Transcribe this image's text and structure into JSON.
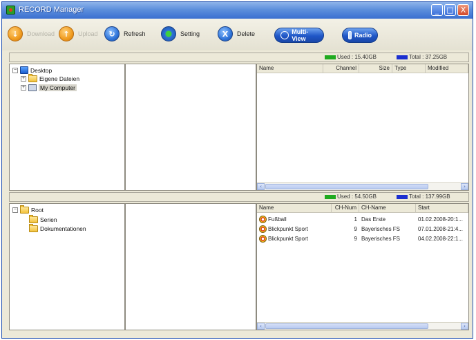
{
  "window": {
    "title": "RECORD Manager",
    "min_glyph": "_",
    "max_glyph": "□",
    "close_glyph": "X"
  },
  "toolbar": {
    "download": "Download",
    "upload": "Upload",
    "refresh": "Refresh",
    "setting": "Setting",
    "delete": "Delete",
    "multiview": "Multi-View",
    "radio": "Radio"
  },
  "top_status": {
    "used": "Used : 15.40GB",
    "total": "Total : 37.25GB"
  },
  "top_tree": {
    "desktop": "Desktop",
    "eigene_dateien": "Eigene Dateien",
    "my_computer": "My Computer"
  },
  "top_list": {
    "columns": [
      "Name",
      "Channel",
      "Size",
      "Type",
      "Modified"
    ]
  },
  "bottom_status": {
    "used": "Used : 54.50GB",
    "total": "Total : 137.99GB"
  },
  "bottom_tree": {
    "root": "Root",
    "serien": "Serien",
    "dokumentationen": "Dokumentationen"
  },
  "bottom_list": {
    "columns": [
      "Name",
      "CH-Num",
      "CH-Name",
      "Start"
    ],
    "rows": [
      {
        "name": "Fußball",
        "ch_num": "1",
        "ch_name": "Das Erste",
        "start": "01.02.2008-20:1..."
      },
      {
        "name": "Blickpunkt Sport",
        "ch_num": "9",
        "ch_name": "Bayerisches FS",
        "start": "07.01.2008-21:4..."
      },
      {
        "name": "Blickpunkt Sport",
        "ch_num": "9",
        "ch_name": "Bayerisches FS",
        "start": "04.02.2008-22:1..."
      }
    ]
  },
  "colors": {
    "used": "#1faa1f",
    "total": "#1b2fd0",
    "titlebar": "#3a6fd0"
  },
  "icons": [
    "download-icon",
    "upload-icon",
    "refresh-icon",
    "setting-icon",
    "delete-icon",
    "multiview-icon",
    "radio-icon",
    "folder-icon",
    "desktop-icon",
    "computer-icon",
    "recording-icon"
  ]
}
